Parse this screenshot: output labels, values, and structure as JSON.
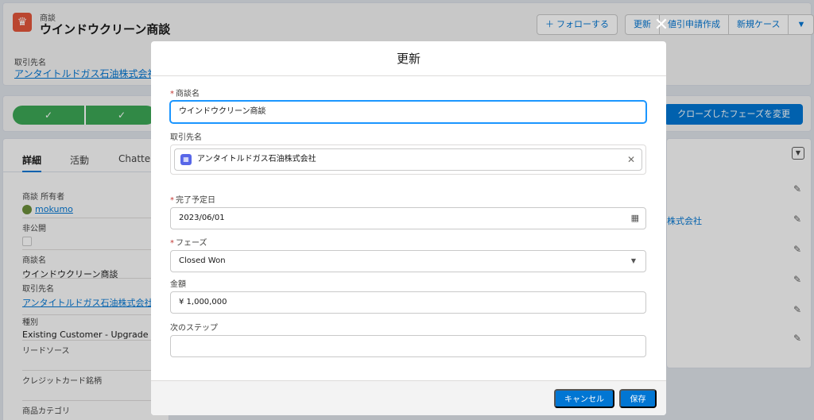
{
  "page": {
    "object_type": "商談",
    "record_title": "ウインドウクリーン商談",
    "actions": {
      "follow": "＋ フォローする",
      "update": "更新",
      "discount": "値引申請作成",
      "new_case": "新規ケース"
    },
    "account_label": "取引先名",
    "account_value": "アンタイトルドガス石油株式会社",
    "path_check": "✓",
    "change_phase_button": "クローズしたフェーズを変更",
    "tabs": [
      "詳細",
      "活動",
      "Chatter"
    ],
    "details": {
      "owner_label": "商談 所有者",
      "owner_value": "mokumo",
      "private_label": "非公開",
      "name_label": "商談名",
      "name_value": "ウインドウクリーン商談",
      "account_label": "取引先名",
      "account_value": "アンタイトルドガス石油株式会社",
      "type_label": "種別",
      "type_value": "Existing Customer - Upgrade",
      "lead_source_label": "リードソース",
      "credit_label": "クレジットカード銘柄",
      "product_category_label": "商品カテゴリ"
    },
    "right_partial_text": "株式会社"
  },
  "modal": {
    "title": "更新",
    "close_label": "✕",
    "fields": {
      "opportunity_name_label": "商談名",
      "opportunity_name_value": "ウインドウクリーン商談",
      "account_label": "取引先名",
      "account_value": "アンタイトルドガス石油株式会社",
      "close_date_label": "完了予定日",
      "close_date_value": "2023/06/01",
      "stage_label": "フェーズ",
      "stage_value": "Closed Won",
      "amount_label": "金額",
      "amount_value": "¥ 1,000,000",
      "next_step_label": "次のステップ",
      "next_step_value": ""
    },
    "required_marker": "*",
    "cancel_button": "キャンセル",
    "save_button": "保存"
  },
  "colors": {
    "brand_blue": "#0176d3",
    "path_green": "#3ba755",
    "required_red": "#c23934",
    "object_icon": "#e2553a",
    "account_icon": "#5867e8"
  },
  "icons": {
    "object": "crown-icon",
    "account": "account-icon",
    "calendar": "calendar-icon",
    "clear": "clear-icon",
    "dropdown": "chevron-down-icon",
    "edit": "pencil-icon"
  }
}
